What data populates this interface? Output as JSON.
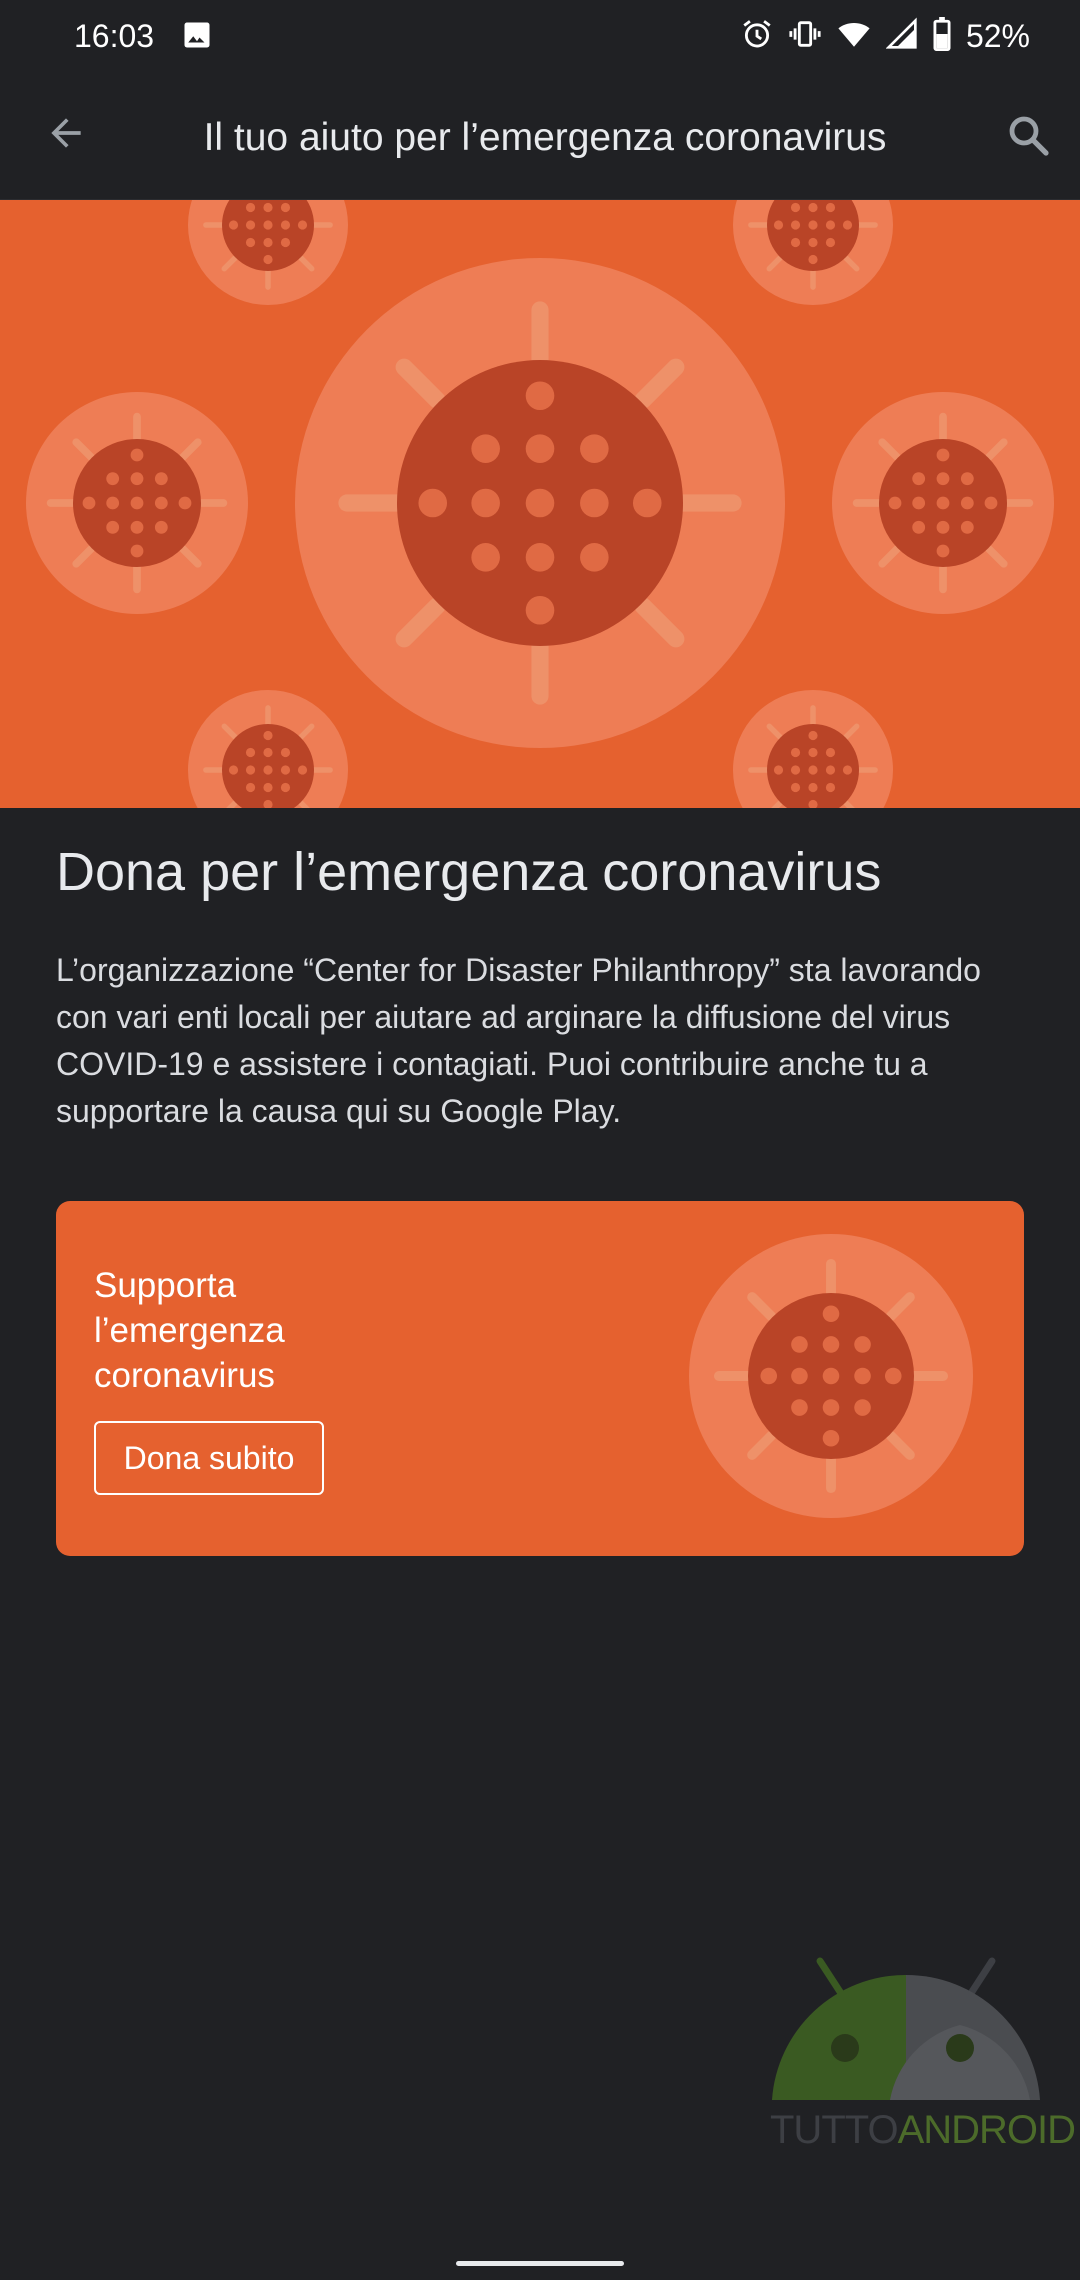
{
  "status_bar": {
    "time": "16:03",
    "battery": "52%",
    "icons": [
      "image-icon",
      "alarm-icon",
      "vibrate-icon",
      "wifi-icon",
      "signal-icon",
      "battery-icon"
    ]
  },
  "app_bar": {
    "title": "Il tuo aiuto per l’emergenza coronavirus",
    "back_icon": "arrow-back-icon",
    "search_icon": "search-icon"
  },
  "hero": {
    "illustration": "virus-pattern",
    "colors": {
      "background": "#e5612f",
      "halo": "#ee7d55",
      "virus": "#b94427",
      "dots": "#e5612f"
    }
  },
  "content": {
    "headline": "Dona per l’emergenza coronavirus",
    "body": "L’organizzazione “Center for Disaster Philanthropy” sta lavorando con vari enti locali per aiutare ad arginare la diffusione del virus COVID-19 e assistere i contagiati. Puoi contribuire anche tu a supportare la causa qui su Google Play."
  },
  "card": {
    "title": "Supporta l’emergenza coronavirus",
    "button_label": "Dona subito",
    "colors": {
      "background": "#e5612f"
    }
  },
  "watermark": {
    "text_part1": "TUTTO",
    "text_part2": "ANDROID"
  }
}
